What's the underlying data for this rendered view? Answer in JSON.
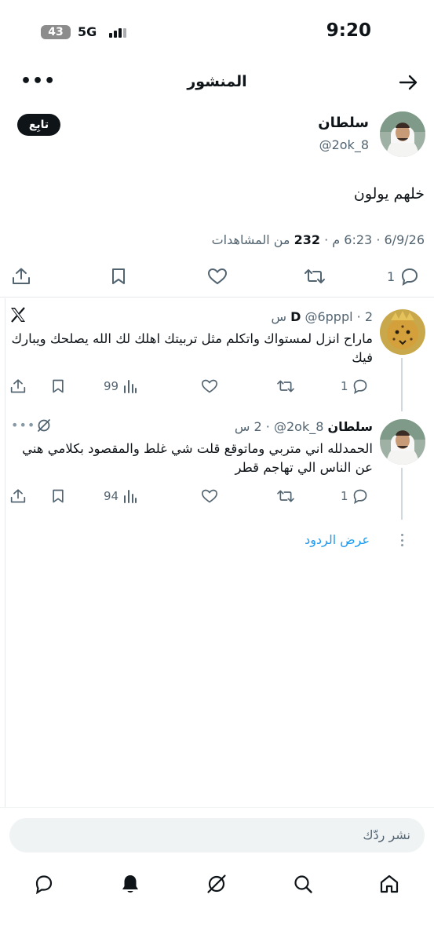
{
  "status": {
    "time": "9:20",
    "network": "5G",
    "battery": "43"
  },
  "header": {
    "title": "المنشور"
  },
  "post": {
    "author_name": "سلطان",
    "author_handle": "@2ok_8",
    "follow_label": "تابِع",
    "text": "خلهم يولون",
    "date": "6/9/26",
    "time": "6:23 م",
    "dot": "·",
    "views_count": "232",
    "views_label": "من المشاهدات",
    "replies_count": "1"
  },
  "replies": [
    {
      "name": "D",
      "handle": "@6pppl",
      "time": "2 س",
      "text": "ماراح انزل لمستواك واتكلم مثل تربيتك اهلك لك الله يصلحك ويبارك فيك",
      "reply_count": "1",
      "views": "99"
    },
    {
      "name": "سلطان",
      "handle": "@2ok_8",
      "time": "2 س",
      "text": "الحمدلله اني متربي وماتوقع قلت شي غلط والمقصود بكلامي هني عن الناس الي تهاجم قطر",
      "reply_count": "1",
      "views": "94"
    }
  ],
  "show_replies": "عرض الردود",
  "compose": {
    "placeholder": "نشر ردّك"
  },
  "icons": {
    "back": "arrow-right-icon",
    "more": "more-icon",
    "reply": "reply-icon",
    "repost": "repost-icon",
    "like": "heart-icon",
    "bookmark": "bookmark-icon",
    "share": "share-icon",
    "views": "views-chart-icon",
    "x_logo": "x-logo-icon",
    "grok": "grok-icon",
    "nav": [
      "home-icon",
      "search-icon",
      "grok-icon",
      "notifications-icon",
      "messages-icon"
    ]
  },
  "colors": {
    "accent": "#1d9bf0",
    "text": "#0f1419",
    "muted": "#536471"
  }
}
